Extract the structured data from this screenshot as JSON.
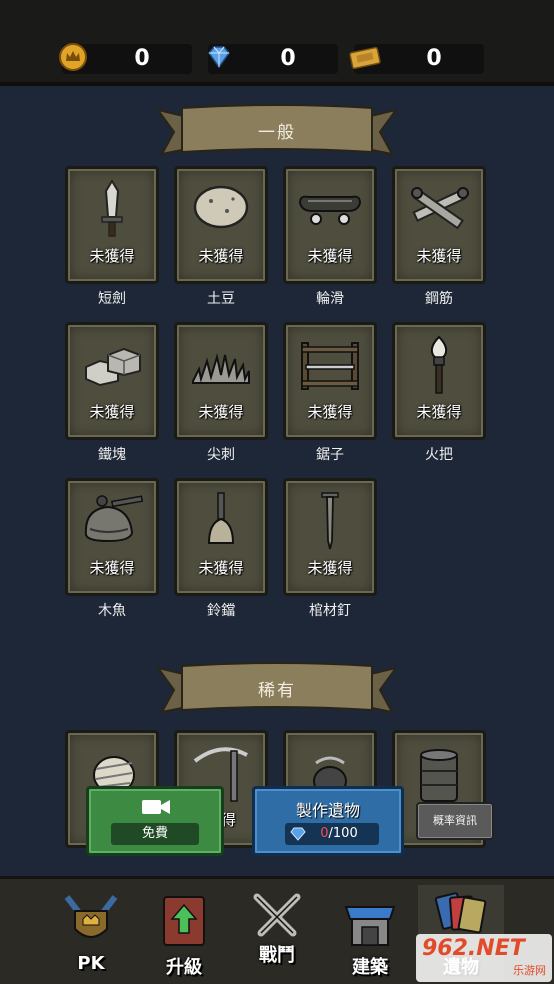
{
  "currencies": [
    {
      "icon": "crown-coin-icon",
      "value": "0"
    },
    {
      "icon": "diamond-icon",
      "value": "0"
    },
    {
      "icon": "ticket-icon",
      "value": "0"
    }
  ],
  "sections": {
    "common": {
      "title": "一般",
      "items": [
        {
          "name": "短劍",
          "status": "未獲得",
          "icon": "short-sword-icon"
        },
        {
          "name": "土豆",
          "status": "未獲得",
          "icon": "potato-icon"
        },
        {
          "name": "輪滑",
          "status": "未獲得",
          "icon": "skateboard-icon"
        },
        {
          "name": "鋼筋",
          "status": "未獲得",
          "icon": "rebar-icon"
        },
        {
          "name": "鐵塊",
          "status": "未獲得",
          "icon": "iron-block-icon"
        },
        {
          "name": "尖刺",
          "status": "未獲得",
          "icon": "spikes-icon"
        },
        {
          "name": "鋸子",
          "status": "未獲得",
          "icon": "saw-icon"
        },
        {
          "name": "火把",
          "status": "未獲得",
          "icon": "torch-icon"
        },
        {
          "name": "木魚",
          "status": "未獲得",
          "icon": "wooden-fish-icon"
        },
        {
          "name": "鈴鐺",
          "status": "未獲得",
          "icon": "bell-icon"
        },
        {
          "name": "棺材釘",
          "status": "未獲得",
          "icon": "coffin-nail-icon"
        }
      ]
    },
    "rare": {
      "title": "稀有",
      "items": [
        {
          "status": "",
          "icon": "bandage-icon"
        },
        {
          "status": "獲得",
          "icon": "pickaxe-icon"
        },
        {
          "status": "",
          "icon": "chain-icon"
        },
        {
          "status": "",
          "icon": "barrel-icon"
        }
      ]
    }
  },
  "actions": {
    "free_label": "免費",
    "craft_title": "製作遺物",
    "craft_cost_current": "0",
    "craft_cost_total": "/100",
    "odds_label": "概率資訊"
  },
  "nav": [
    {
      "label": "PK",
      "icon": "pk-shield-icon"
    },
    {
      "label": "升級",
      "icon": "upgrade-book-icon"
    },
    {
      "label": "戰鬥",
      "icon": "crossed-swords-icon"
    },
    {
      "label": "建築",
      "icon": "shop-building-icon"
    },
    {
      "label": "遺物",
      "icon": "relic-cards-icon"
    }
  ],
  "watermark": {
    "brand": "962.NET",
    "sub": "乐游网"
  },
  "colors": {
    "accent_green": "#3d8a43",
    "accent_blue": "#2f6da6",
    "cost_red": "#ff4a4a"
  }
}
